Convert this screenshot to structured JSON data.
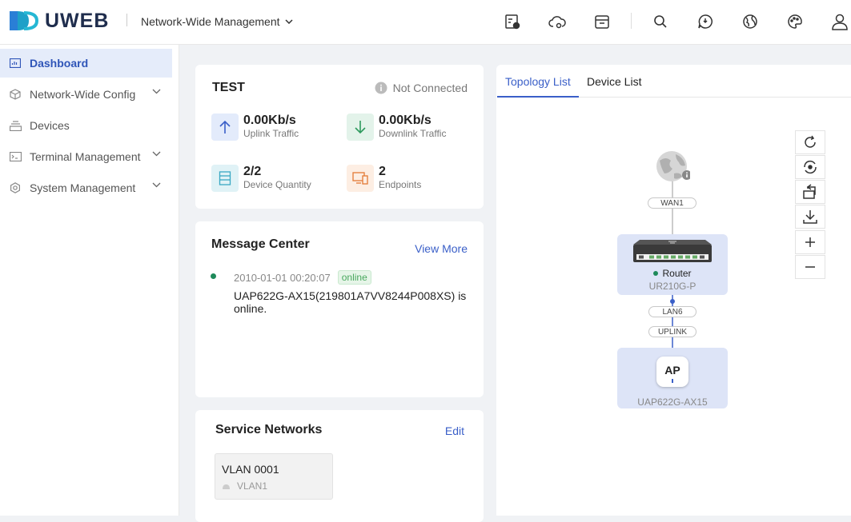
{
  "header": {
    "logo_text": "UWEB",
    "scope_selector": "Network-Wide Management"
  },
  "sidebar": {
    "items": [
      {
        "label": "Dashboard"
      },
      {
        "label": "Network-Wide Config"
      },
      {
        "label": "Devices"
      },
      {
        "label": "Terminal Management"
      },
      {
        "label": "System Management"
      }
    ]
  },
  "overview": {
    "site_name": "TEST",
    "status": "Not Connected",
    "uplink_value": "0.00Kb/s",
    "uplink_label": "Uplink Traffic",
    "downlink_value": "0.00Kb/s",
    "downlink_label": "Downlink Traffic",
    "device_value": "2/2",
    "device_label": "Device Quantity",
    "endpoint_value": "2",
    "endpoint_label": "Endpoints"
  },
  "messages": {
    "title": "Message Center",
    "view_more": "View More",
    "items": [
      {
        "time": "2010-01-01 00:20:07",
        "badge": "online",
        "text": "UAP622G-AX15(219801A7VV8244P008XS) is online."
      }
    ]
  },
  "service_networks": {
    "title": "Service Networks",
    "edit": "Edit",
    "items": [
      {
        "name": "VLAN 0001",
        "sub": "VLAN1"
      }
    ]
  },
  "topology": {
    "tabs": [
      "Topology List",
      "Device List"
    ],
    "wan_port": "WAN1",
    "router_label": "Router",
    "router_model": "UR210G-P",
    "lan_port": "LAN6",
    "uplink_port": "UPLINK",
    "ap_badge": "AP",
    "ap_model": "UAP622G-AX15"
  },
  "colors": {
    "accent": "#3a5fc8",
    "online": "#1e8a5a"
  }
}
